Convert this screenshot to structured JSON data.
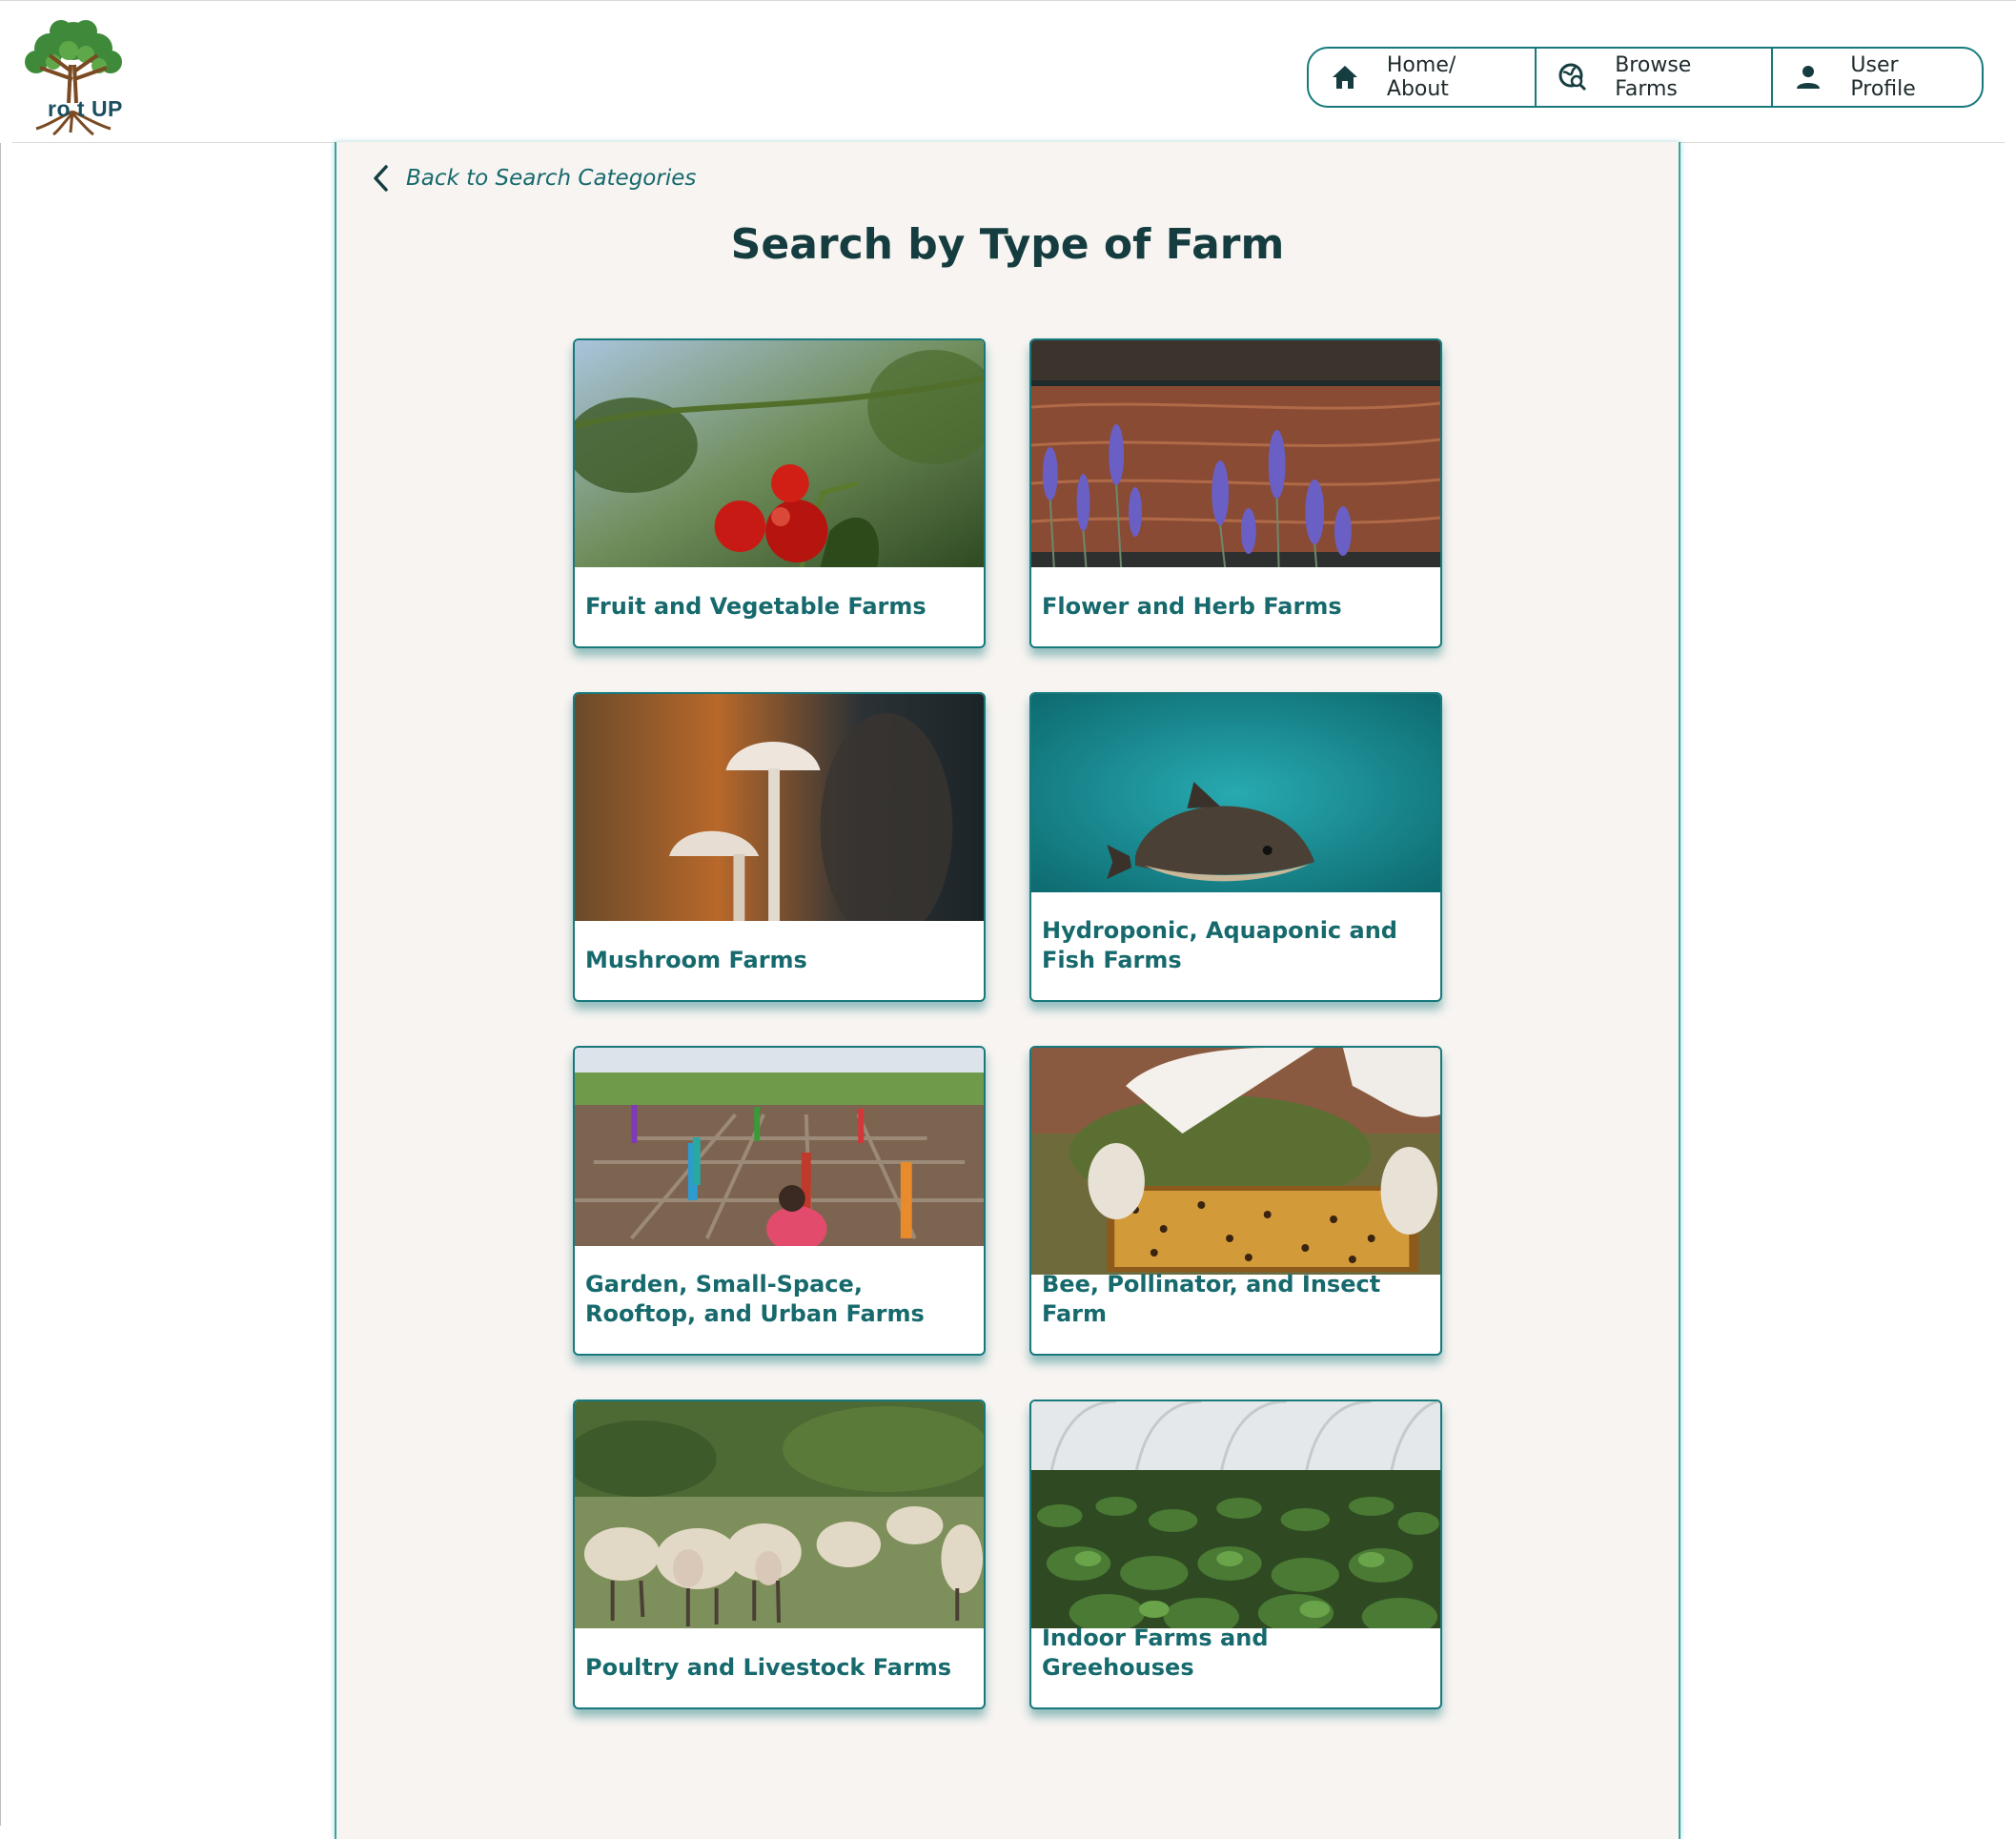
{
  "brand": {
    "logo_text": "ro t UP"
  },
  "nav": {
    "items": [
      {
        "label": "Home/ About",
        "icon": "home-icon"
      },
      {
        "label": "Browse Farms",
        "icon": "globe-search-icon"
      },
      {
        "label": "User Profile",
        "icon": "user-icon"
      }
    ]
  },
  "page": {
    "back_label": "Back to Search Categories",
    "title": "Search by Type of Farm"
  },
  "categories": [
    {
      "label": "Fruit and Vegetable Farms",
      "image": "tomatoes-photo"
    },
    {
      "label": "Flower and Herb Farms",
      "image": "lavender-photo"
    },
    {
      "label": "Mushroom Farms",
      "image": "mushrooms-photo"
    },
    {
      "label": "Hydroponic, Aquaponic and Fish Farms",
      "image": "fish-photo"
    },
    {
      "label": "Garden, Small-Space, Rooftop, and Urban Farms",
      "image": "urban-garden-photo"
    },
    {
      "label": "Bee, Pollinator, and Insect Farm",
      "image": "beehive-frame-photo"
    },
    {
      "label": "Poultry and Livestock Farms",
      "image": "sheep-photo"
    },
    {
      "label": "Indoor Farms and Greehouses",
      "image": "greenhouse-photo"
    }
  ],
  "colors": {
    "accent": "#17797c",
    "title": "#153d40",
    "panel_bg": "#f7f4f1"
  }
}
